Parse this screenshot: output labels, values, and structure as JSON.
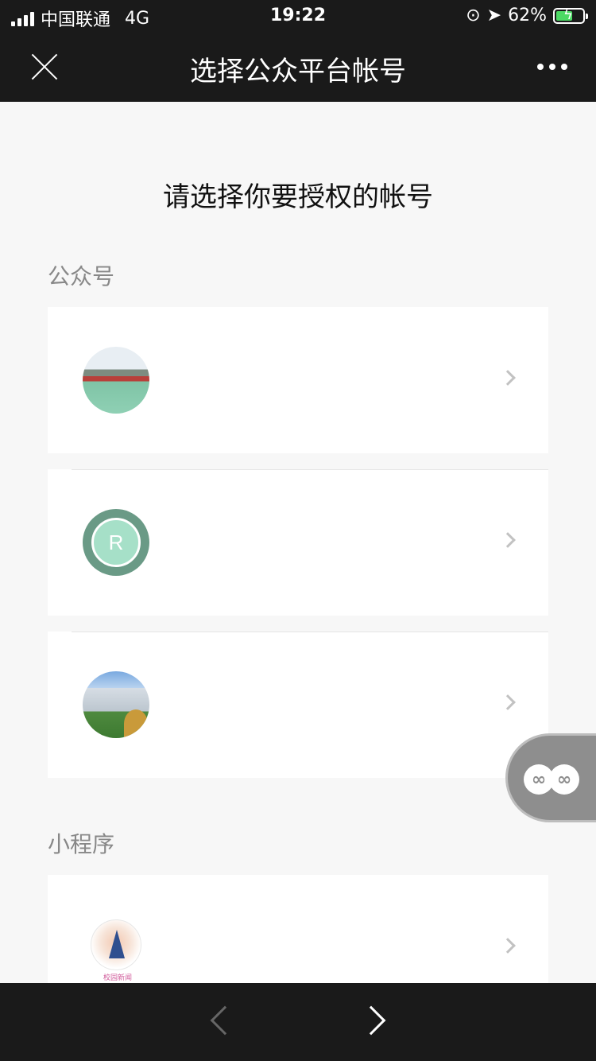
{
  "status_bar": {
    "carrier": "中国联通",
    "network": "4G",
    "time": "19:22",
    "battery": "62%",
    "battery_level": 0.62,
    "battery_color": "#4cd964"
  },
  "nav": {
    "title": "选择公众平台帐号",
    "close_icon": "close-icon",
    "more_icon": "more-dots-icon"
  },
  "heading": "请选择你要授权的帐号",
  "sections": {
    "official": {
      "label": "公众号"
    },
    "mini": {
      "label": "小程序",
      "caption": "校园新闻"
    }
  },
  "accounts": [
    {
      "avatar": "campus-gate-avatar"
    },
    {
      "avatar": "letter-avatar",
      "initial": "R"
    },
    {
      "avatar": "building-avatar"
    }
  ],
  "mini_programs": [
    {
      "avatar": "mini-program-avatar"
    }
  ],
  "floating": {
    "icon": "link-icon"
  },
  "toolbar": {
    "back_icon": "back-chevron-icon",
    "forward_icon": "forward-chevron-icon"
  }
}
